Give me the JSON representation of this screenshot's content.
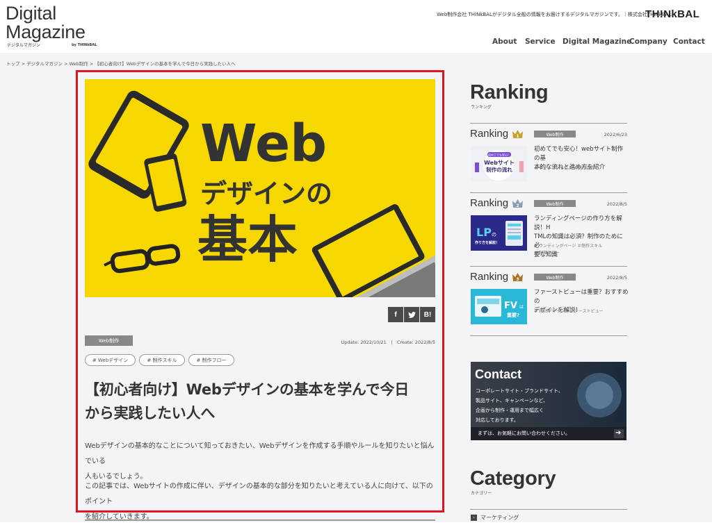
{
  "header": {
    "logo_line1": "Digital",
    "logo_line2": "Magazine",
    "logo_sub": "デジタルマガジン",
    "logo_by": "by THINkBAL",
    "tagline": "Web制作会社 THINkBALがデジタル全般の情報をお届けするデジタルマガジンです。｜株式会社THINkBAL",
    "brand": "TH!NkBAL",
    "nav": [
      "About",
      "Service",
      "Digital Magazine",
      "Company",
      "Contact"
    ]
  },
  "breadcrumb": "トップ > デジタルマガジン > Web制作 > 【初心者向け】Webデザインの基本を学んで今日から実践したい人へ",
  "article": {
    "hero_line1": "Web",
    "hero_line2": "デザインの",
    "hero_line3": "基本",
    "share": [
      "f",
      "t",
      "B!"
    ],
    "category": "Web制作",
    "dates": "Update: 2022/10/21　|　Create: 2022/8/5",
    "tags": [
      "# Webデザイン",
      "# 制作スキル",
      "# 制作フロー"
    ],
    "title_line1": "【初心者向け】Webデザインの基本を学んで今日",
    "title_line2": "から実践したい人へ",
    "para1_line1": "Webデザインの基本的なことについて知っておきたい、Webデザインを作成する手順やルールを知りたいと悩んでいる",
    "para1_line2": "人もいるでしょう。",
    "para2_line1": "この記事では、Webサイトの作成に伴い、デザインの基本的な部分を知りたいと考えている人に向けて、以下のポイント",
    "para2_line2": "を紹介していきます。"
  },
  "sidebar": {
    "ranking_title": "Ranking",
    "ranking_sub": "ランキング",
    "rank_label": "Ranking",
    "ranks": [
      {
        "num": "1",
        "category": "Web制作",
        "date": "2022/6/23",
        "title_line1": "初めてでも安心！webサイト制作の基",
        "title_line2": "本的な流れと進め方を紹介",
        "tags_line1": "# サイトコンセプト ＃制作会社",
        "tags_line2": "",
        "thumb_text1": "初めてでも安心！",
        "thumb_text2": "Webサイト",
        "thumb_text3": "制作の流れ"
      },
      {
        "num": "2",
        "category": "Web制作",
        "date": "2022/8/5",
        "title_line1": "ランディングページの作り方を解説！H",
        "title_line2": "TMLの知識は必須？制作のために必",
        "title_line3": "要な知識",
        "tags_line1": "# ランディングページ ＃制作スキル",
        "tags_line2": "# 制作フロー",
        "thumb_text1": "LP",
        "thumb_text2": "の",
        "thumb_text3": "作り方を解説！"
      },
      {
        "num": "3",
        "category": "Web制作",
        "date": "2022/8/5",
        "title_line1": "ファーストビューは重要？おすすめの",
        "title_line2": "デザインを解説！",
        "tags_line1": "# Webデザイン ＃ファーストビュー",
        "tags_line2": "",
        "thumb_text1": "FV",
        "thumb_text2": "は",
        "thumb_text3": "重要?"
      }
    ],
    "contact_title": "Contact",
    "contact_line1": "コーポレートサイト・ブランドサイト、",
    "contact_line2": "製品サイト、キャンペーンなど、",
    "contact_line3": "企画から制作・運用まで幅広く",
    "contact_line4": "対応しております。",
    "contact_cta": "まずは、お気軽にお問い合わせください。",
    "category_title": "Category",
    "category_sub": "カテゴリー",
    "category_first": "マーケティング"
  },
  "colors": {
    "hero_yellow": "#f6d800",
    "highlight_red": "#e0141e",
    "crown_gold": "#c9a227",
    "crown_silver": "#8a9bb0",
    "crown_bronze": "#a8742a"
  }
}
